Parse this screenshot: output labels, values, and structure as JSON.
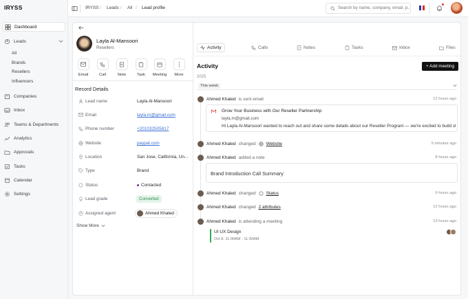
{
  "app": {
    "logo": "IRYSS"
  },
  "sidebar": {
    "items": [
      {
        "label": "Dashboard",
        "icon": "dashboard-icon"
      },
      {
        "label": "Leads",
        "icon": "leads-icon"
      },
      {
        "label": "Companies",
        "icon": "companies-icon"
      },
      {
        "label": "Inbox",
        "icon": "inbox-icon"
      },
      {
        "label": "Teams & Departments",
        "icon": "teams-icon"
      },
      {
        "label": "Analytics",
        "icon": "analytics-icon"
      },
      {
        "label": "Approvals",
        "icon": "approvals-icon"
      },
      {
        "label": "Tasks",
        "icon": "tasks-icon"
      },
      {
        "label": "Calendar",
        "icon": "calendar-icon"
      },
      {
        "label": "Settings",
        "icon": "settings-icon"
      }
    ],
    "leads_sub": [
      "All",
      "Brands",
      "Resellers",
      "Influencers"
    ]
  },
  "topbar": {
    "breadcrumb": [
      "IRYSS",
      "Leads",
      "All",
      "Lead profile"
    ],
    "search_placeholder": "Search by name, company, email, p..."
  },
  "profile": {
    "name": "Layla Al-Mansoori",
    "subtitle": "Resellers",
    "actions": [
      "Email",
      "Call",
      "Note",
      "Task",
      "Meeting",
      "More"
    ],
    "section_title": "Record Details",
    "fields": [
      {
        "label": "Lead name",
        "value": "Layla Al-Mansoori",
        "icon": "user-icon"
      },
      {
        "label": "Email",
        "value": "layla.m@gmail.com",
        "icon": "mail-icon"
      },
      {
        "label": "Phone number",
        "value": "+201032505817",
        "icon": "phone-icon"
      },
      {
        "label": "Website",
        "value": "paypal.com",
        "icon": "globe-icon"
      },
      {
        "label": "Location",
        "value": "San Jose, California, Un...",
        "icon": "pin-icon"
      },
      {
        "label": "Type",
        "value": "Brand",
        "icon": "tag-icon"
      },
      {
        "label": "Status",
        "value": "Contacted",
        "icon": "status-icon"
      },
      {
        "label": "Lead grade",
        "value": "Converted",
        "icon": "grade-icon"
      },
      {
        "label": "Assigned agent",
        "value": "Ahmed Khaled",
        "icon": "agent-icon"
      }
    ],
    "show_more": "Show More"
  },
  "activity": {
    "tabs": [
      "Activity",
      "Calls",
      "Notes",
      "Tasks",
      "Inbox",
      "Files"
    ],
    "title": "Activity",
    "add_meeting": "+ Add meeting",
    "year": "2025",
    "group": "This week",
    "entries": [
      {
        "actor": "Ahmed Khaled",
        "action": "is sent email",
        "extra": "",
        "time": "12 hours ago"
      },
      {
        "actor": "Ahmed Khaled",
        "action": "changed",
        "extra": "Website",
        "time": "5 minutes ago"
      },
      {
        "actor": "Ahmed Khaled",
        "action": "added a note",
        "extra": "",
        "time": "8 hours ago"
      },
      {
        "actor": "Ahmed Khaled",
        "action": "changed",
        "extra": "Status",
        "time": "9 hours ago"
      },
      {
        "actor": "Ahmed Khaled",
        "action": "changed",
        "extra": "2 attributes",
        "time": "12 hours ago"
      },
      {
        "actor": "Ahmed Khaled",
        "action": "is attending a meeting",
        "extra": "",
        "time": "13 hours ago"
      }
    ],
    "email_card": {
      "subject": "Grow Your Business with Our Reseller Partnership",
      "from": "layla.m@gmail.com",
      "preview": "Hi Layla Al-Mansoori wanted to reach out and share some details about our Reseller Program — we're excited to build st..."
    },
    "note_card": {
      "title": "Brand Introduction Call Summary"
    },
    "meeting_card": {
      "title": "UI UX Design",
      "time": "Oct 8, 11:00AM - 11:30AM"
    }
  },
  "colors": {
    "accent": "#111111",
    "status_dot": "#7b2d8e",
    "grade_bg": "#e4f5e9",
    "grade_text": "#2e8b57",
    "link": "#3b6fd4"
  }
}
